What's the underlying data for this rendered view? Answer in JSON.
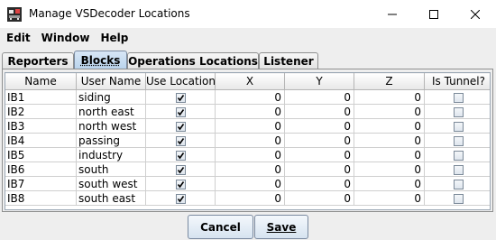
{
  "window": {
    "title": "Manage VSDecoder Locations"
  },
  "menu": [
    "Edit",
    "Window",
    "Help"
  ],
  "tabs": [
    "Reporters",
    "Blocks",
    "Operations Locations",
    "Listener"
  ],
  "selected_tab": "Blocks",
  "table": {
    "headers": [
      "Name",
      "User Name",
      "Use Location",
      "X",
      "Y",
      "Z",
      "Is Tunnel?"
    ],
    "rows": [
      {
        "name": "IB1",
        "user_name": "siding",
        "use_location": true,
        "x": "0",
        "y": "0",
        "z": "0",
        "is_tunnel": false
      },
      {
        "name": "IB2",
        "user_name": "north east",
        "use_location": true,
        "x": "0",
        "y": "0",
        "z": "0",
        "is_tunnel": false
      },
      {
        "name": "IB3",
        "user_name": "north west",
        "use_location": true,
        "x": "0",
        "y": "0",
        "z": "0",
        "is_tunnel": false
      },
      {
        "name": "IB4",
        "user_name": "passing",
        "use_location": true,
        "x": "0",
        "y": "0",
        "z": "0",
        "is_tunnel": false
      },
      {
        "name": "IB5",
        "user_name": "industry",
        "use_location": true,
        "x": "0",
        "y": "0",
        "z": "0",
        "is_tunnel": false
      },
      {
        "name": "IB6",
        "user_name": "south",
        "use_location": true,
        "x": "0",
        "y": "0",
        "z": "0",
        "is_tunnel": false
      },
      {
        "name": "IB7",
        "user_name": "south west",
        "use_location": true,
        "x": "0",
        "y": "0",
        "z": "0",
        "is_tunnel": false
      },
      {
        "name": "IB8",
        "user_name": "south east",
        "use_location": true,
        "x": "0",
        "y": "0",
        "z": "0",
        "is_tunnel": false
      }
    ]
  },
  "buttons": {
    "cancel": "Cancel",
    "save": "Save"
  },
  "icons": {
    "app": "jmri-app-icon",
    "minimize": "minimize-icon",
    "maximize": "maximize-icon",
    "close": "close-icon",
    "checkbox": "checkbox-icon"
  }
}
